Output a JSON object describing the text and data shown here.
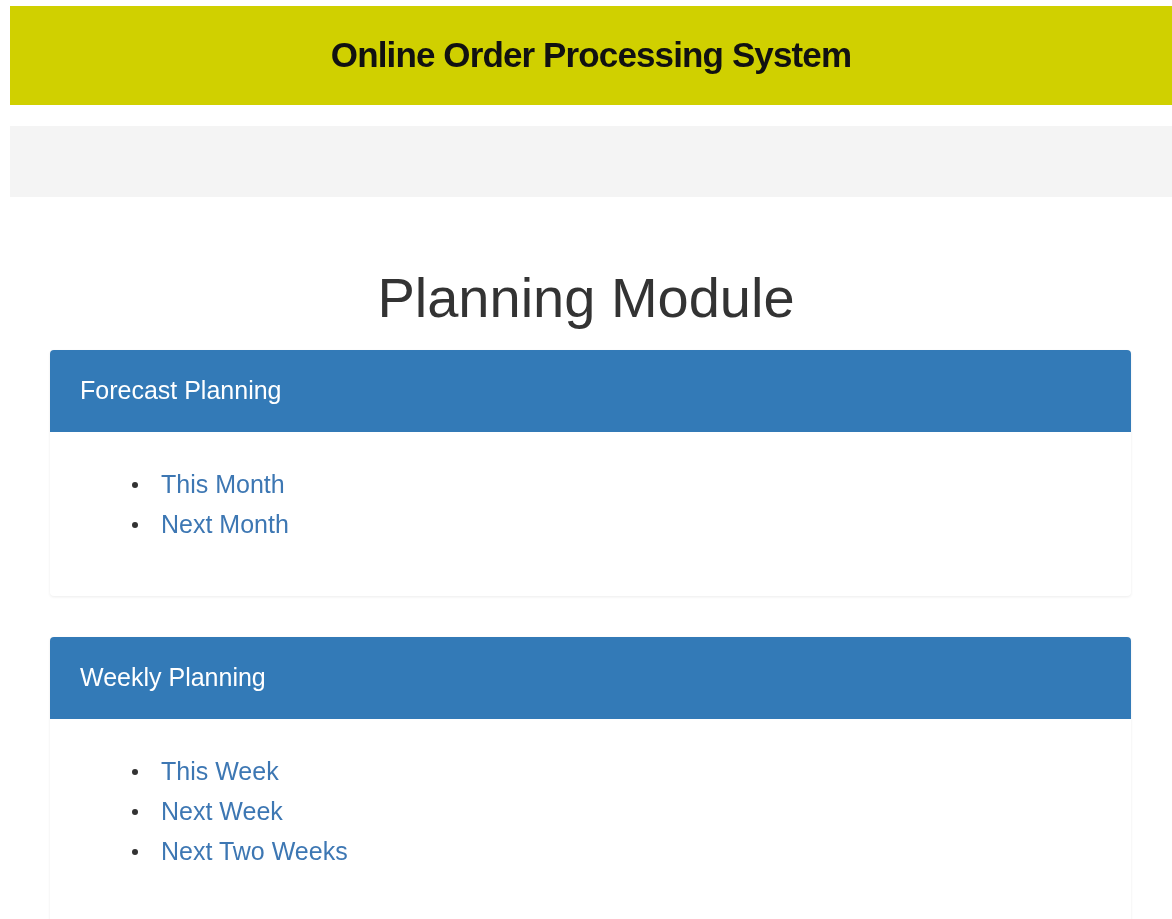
{
  "header": {
    "title": "Online Order Processing System"
  },
  "page_title": "Planning Module",
  "panels": [
    {
      "title": "Forecast Planning",
      "links": [
        "This Month",
        "Next Month"
      ]
    },
    {
      "title": "Weekly Planning",
      "links": [
        "This Week",
        "Next Week",
        "Next Two Weeks"
      ]
    }
  ]
}
